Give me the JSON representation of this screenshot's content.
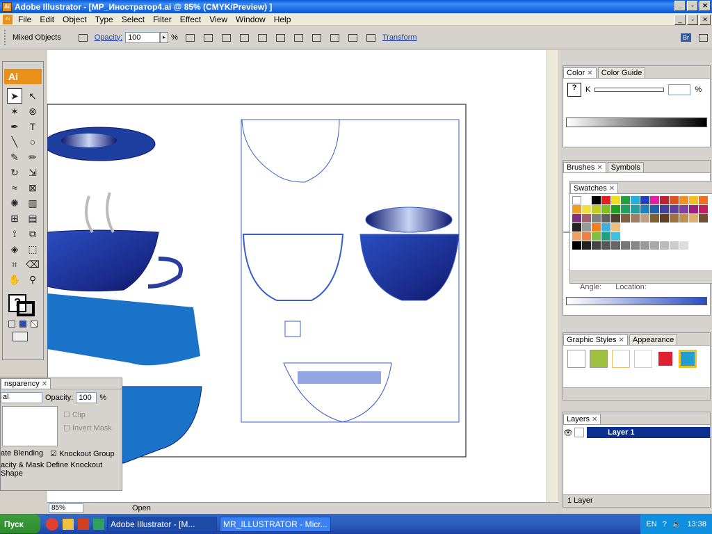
{
  "window": {
    "title": "Adobe Illustrator - [MP_Иностратор4.ai @ 85% (CMYK/Preview) ]"
  },
  "menu": [
    "File",
    "Edit",
    "Object",
    "Type",
    "Select",
    "Filter",
    "Effect",
    "View",
    "Window",
    "Help"
  ],
  "control": {
    "selection": "Mixed Objects",
    "opacity_label": "Opacity:",
    "opacity_value": "100",
    "percent": "%",
    "transform": "Transform",
    "br": "Br"
  },
  "toolbox": {
    "logo": "Ai"
  },
  "panels": {
    "color_tabs": [
      "Color",
      "Color Guide"
    ],
    "color_k": "K",
    "color_pct": "%",
    "brushes_tabs": [
      "Brushes",
      "Symbols"
    ],
    "swatches_tab": "Swatches",
    "gradient_angle": "Angle:",
    "gradient_location": "Location:",
    "graphic_tabs": [
      "Graphic Styles",
      "Appearance"
    ],
    "layers_tab": "Layers",
    "layer_name": "Layer 1",
    "layers_count": "1 Layer"
  },
  "transparency": {
    "tab": "nsparency",
    "mode": "al",
    "opacity_label": "Opacity:",
    "opacity_value": "100",
    "percent": "%",
    "clip": "Clip",
    "invert_mask": "Invert Mask",
    "isolate": "ate Blending",
    "knockout": "Knockout Group",
    "opacity_mask": "acity & Mask Define Knockout Shape"
  },
  "status": {
    "zoom": "85%",
    "mode": "Open"
  },
  "taskbar": {
    "start": "Пуск",
    "item1": "Adobe Illustrator - [M...",
    "item2": "MR_ILLUSTRATOR - Micr...",
    "lang": "EN",
    "time": "13:38"
  },
  "colors": {
    "accent": "#e8901a",
    "selection": "#3a5ccc",
    "cup_blue": "#1e3fa0"
  }
}
